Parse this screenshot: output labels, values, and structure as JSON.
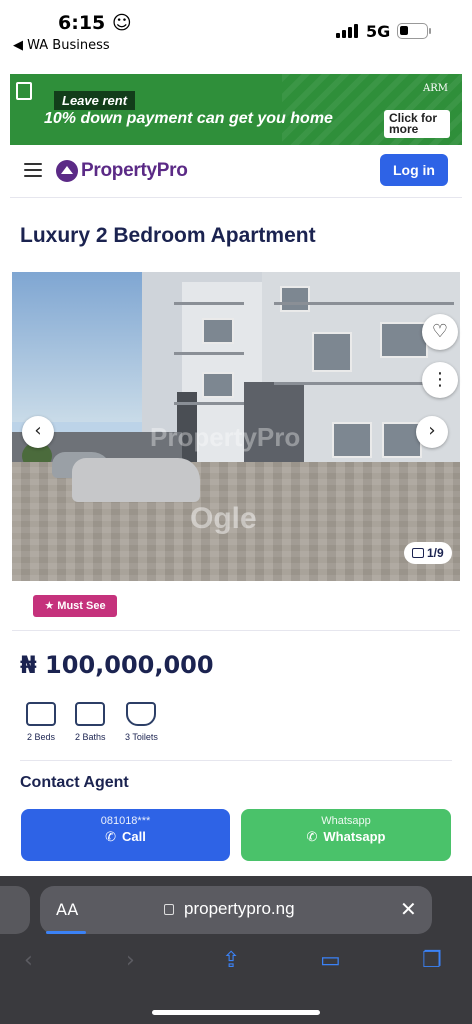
{
  "status": {
    "time": "6:15",
    "emoji": "☺",
    "back_app": "◀ WA Business",
    "network": "5G"
  },
  "banner": {
    "tag": "Leave rent",
    "headline": "10% down payment can get you home",
    "brand": "ARM",
    "cta": "Click for more"
  },
  "header": {
    "logo_text": "PropertyPro",
    "login_label": "Log in"
  },
  "listing": {
    "title": "Luxury 2 Bedroom Apartment",
    "image_counter": "1/9",
    "watermark": "PropertyPro",
    "watermark2": "Ogle",
    "badge": "Must See",
    "price": "₦ 100,000,000",
    "features": [
      {
        "label": "2 Beds",
        "icon": "bed-icon"
      },
      {
        "label": "2 Baths",
        "icon": "bathtub-icon"
      },
      {
        "label": "3 Toilets",
        "icon": "toilet-icon"
      }
    ]
  },
  "contact": {
    "title": "Contact Agent",
    "call_sub": "081018***",
    "call_label": "Call",
    "wa_sub": "Whatsapp",
    "wa_label": "Whatsapp"
  },
  "safari": {
    "aa_label": "AA",
    "url": "propertypro.ng"
  },
  "colors": {
    "primary": "#2e63e6",
    "brand": "#5b2a86",
    "whatsapp": "#4ac26a",
    "badge": "#c5327c",
    "banner": "#2f8f3a"
  }
}
